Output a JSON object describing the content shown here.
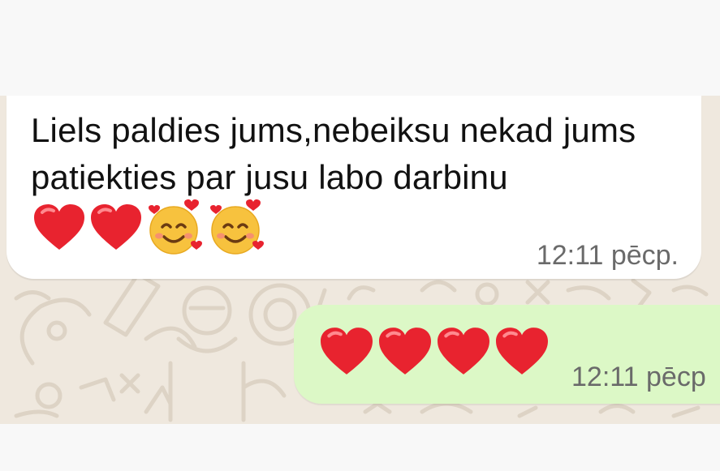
{
  "chat": {
    "incoming": {
      "text": "Liels paldies jums,nebeiksu nekad jums patiekties par jusu labo darbinu",
      "emojis": [
        "red-heart-icon",
        "red-heart-icon",
        "smiling-face-with-hearts-icon",
        "smiling-face-with-hearts-icon"
      ],
      "time": "12:11 pēcp."
    },
    "outgoing": {
      "emojis": [
        "red-heart-icon",
        "red-heart-icon",
        "red-heart-icon",
        "red-heart-icon"
      ],
      "time": "12:11 pēcp"
    }
  },
  "colors": {
    "chat_background": "#efe8de",
    "incoming_bubble": "#ffffff",
    "outgoing_bubble": "#dcf8c6",
    "timestamp": "#6a6a6a"
  }
}
